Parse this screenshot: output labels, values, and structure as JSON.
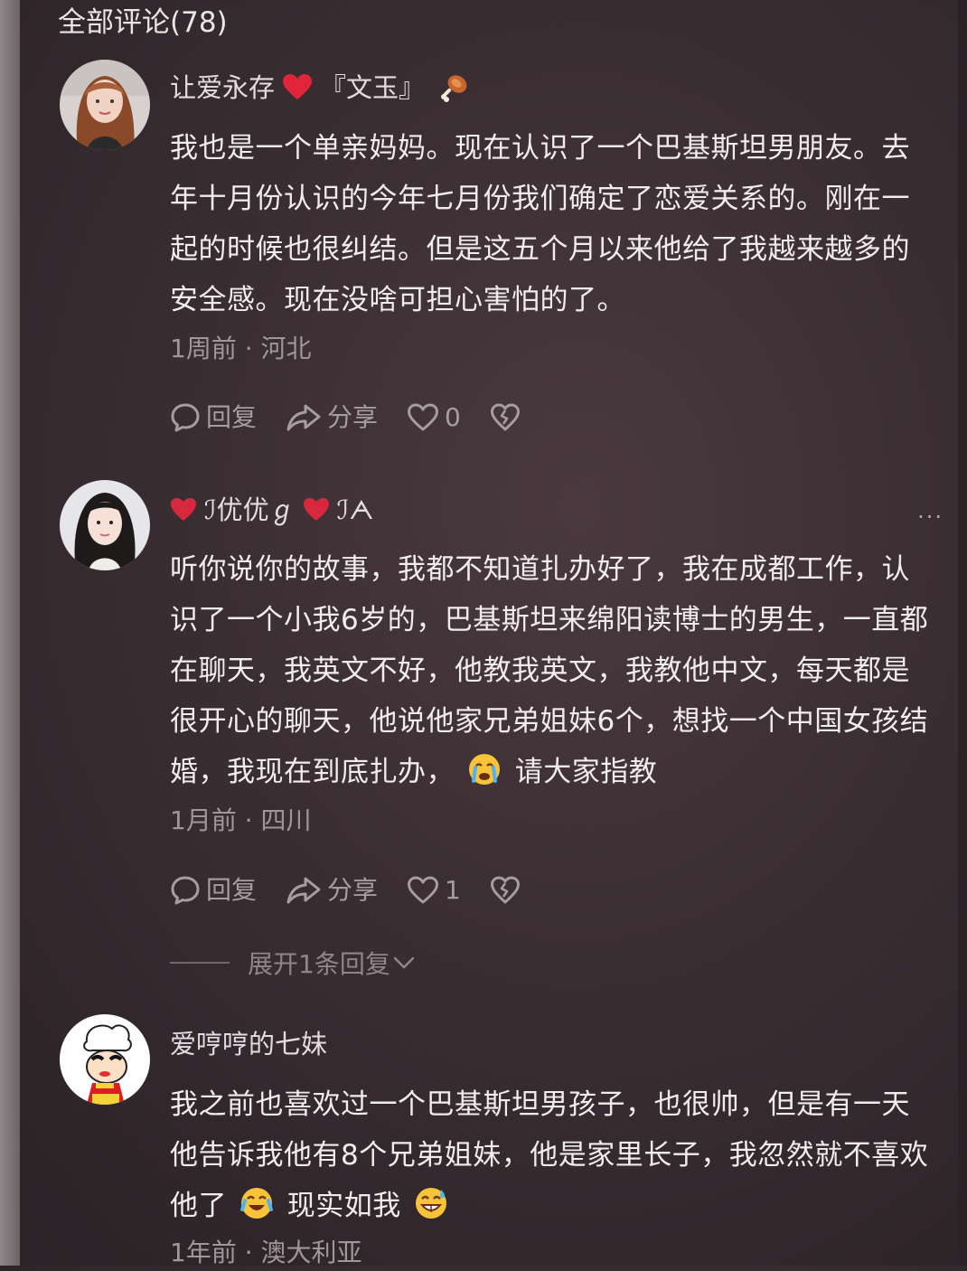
{
  "header": {
    "title": "全部评论(78)"
  },
  "comments": [
    {
      "username": "让爱永存",
      "username_suffix": "『文玉』",
      "text": "我也是一个单亲妈妈。现在认识了一个巴基斯坦男朋友。去年十月份认识的今年七月份我们确定了恋爱关系的。刚在一起的时候也很纠结。但是这五个月以来他给了我越来越多的安全感。现在没啥可担心害怕的了。",
      "time": "1周前",
      "location": "河北",
      "reply_label": "回复",
      "share_label": "分享",
      "like_count": "0"
    },
    {
      "username": "ℐ优优ℊ",
      "username_suffix": "ℐᗅ",
      "text_part1": "听你说你的故事，我都不知道扎办好了，我在成都工作，认识了一个小我6岁的，巴基斯坦来绵阳读博士的男生，一直都在聊天，我英文不好，他教我英文，我教他中文，每天都是很开心的聊天，他说他家兄弟姐妹6个，想找一个中国女孩结婚，我现在到底扎办，",
      "text_part2": "请大家指教",
      "time": "1月前",
      "location": "四川",
      "reply_label": "回复",
      "share_label": "分享",
      "like_count": "1",
      "more": "···",
      "expand_label": "展开1条回复"
    },
    {
      "username": "爱哼哼的七妹",
      "text_part1": "我之前也喜欢过一个巴基斯坦男孩子，也很帅，但是有一天他告诉我他有8个兄弟姐妹，他是家里长子，我忽然就不喜欢他了",
      "text_part2": "现实如我",
      "time": "1年前",
      "location": "澳大利亚"
    }
  ],
  "meta_separator": " · ",
  "icons": {
    "reply": "comment-bubble-icon",
    "share": "share-arrow-icon",
    "like": "heart-icon",
    "dislike": "broken-heart-icon",
    "more": "more-dots-icon",
    "expand": "chevron-down-icon"
  },
  "colors": {
    "background": "#3b2e33",
    "heart_red": "#e0243a",
    "text_primary": "#f1edef",
    "text_secondary": "#9f979b"
  }
}
